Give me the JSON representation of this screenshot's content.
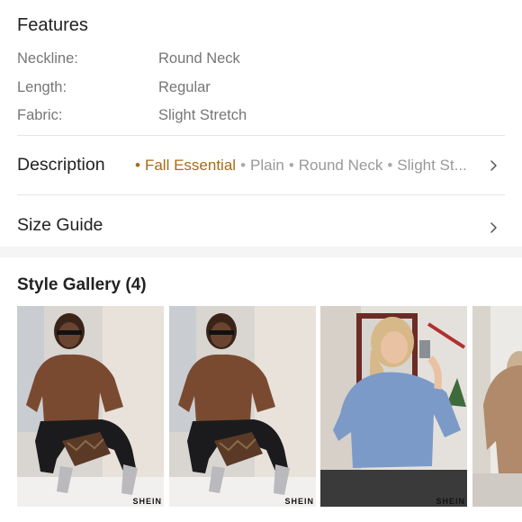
{
  "features": {
    "title": "Features",
    "rows": [
      {
        "label": "Neckline:",
        "value": "Round Neck"
      },
      {
        "label": "Length:",
        "value": "Regular"
      },
      {
        "label": "Fabric:",
        "value": "Slight Stretch"
      }
    ]
  },
  "description": {
    "title": "Description",
    "tags": {
      "t0": "Fall Essential",
      "t1": "Plain",
      "t2": "Round Neck",
      "t3": "Slight St..."
    },
    "separator": "•"
  },
  "size_guide": {
    "title": "Size Guide"
  },
  "gallery": {
    "title": "Style Gallery (4)",
    "watermark": "SHEIN"
  },
  "icons": {
    "description_chevron": "chevron-right-icon",
    "size_guide_chevron": "chevron-right-icon"
  },
  "colors": {
    "accent": "#a86a14",
    "text": "#222222",
    "muted": "#767676",
    "divider": "#e5e5e5"
  }
}
